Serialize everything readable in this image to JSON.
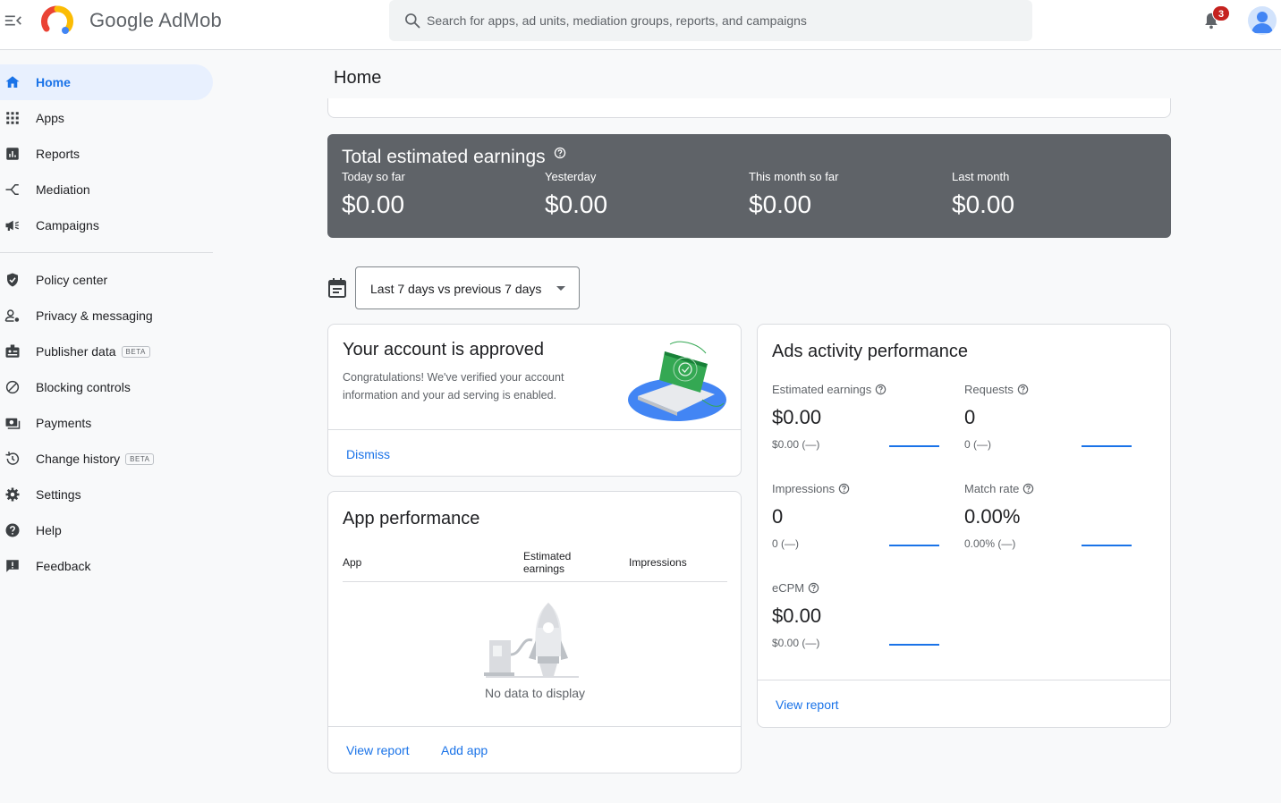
{
  "app": {
    "logo_text": "Google AdMob"
  },
  "search": {
    "placeholder": "Search for apps, ad units, mediation groups, reports, and campaigns"
  },
  "notifications": {
    "count": "3"
  },
  "sidebar": {
    "items": [
      {
        "label": "Home",
        "icon": "home-icon",
        "active": true
      },
      {
        "label": "Apps",
        "icon": "apps-grid-icon"
      },
      {
        "label": "Reports",
        "icon": "reports-icon"
      },
      {
        "label": "Mediation",
        "icon": "mediation-icon"
      },
      {
        "label": "Campaigns",
        "icon": "megaphone-icon"
      },
      {
        "label": "Policy center",
        "icon": "shield-icon"
      },
      {
        "label": "Privacy & messaging",
        "icon": "person-settings-icon"
      },
      {
        "label": "Publisher data",
        "icon": "badge-icon",
        "badge": "BETA"
      },
      {
        "label": "Blocking controls",
        "icon": "block-icon"
      },
      {
        "label": "Payments",
        "icon": "payments-icon"
      },
      {
        "label": "Change history",
        "icon": "history-icon",
        "badge": "BETA"
      },
      {
        "label": "Settings",
        "icon": "gear-icon"
      },
      {
        "label": "Help",
        "icon": "help-icon"
      },
      {
        "label": "Feedback",
        "icon": "feedback-icon"
      }
    ]
  },
  "main": {
    "title": "Home",
    "earnings": {
      "title": "Total estimated earnings",
      "columns": [
        {
          "label": "Today so far",
          "value": "$0.00"
        },
        {
          "label": "Yesterday",
          "value": "$0.00"
        },
        {
          "label": "This month so far",
          "value": "$0.00"
        },
        {
          "label": "Last month",
          "value": "$0.00"
        }
      ]
    },
    "date_range": {
      "label": "Last 7 days vs previous 7 days"
    },
    "approved_card": {
      "title": "Your account is approved",
      "text": "Congratulations! We've verified your account information and your ad serving is enabled.",
      "dismiss": "Dismiss"
    },
    "app_performance": {
      "title": "App performance",
      "columns": [
        "App",
        "Estimated earnings",
        "Impressions"
      ],
      "empty_text": "No data to display",
      "view_report": "View report",
      "add_app": "Add app"
    },
    "ads_activity": {
      "title": "Ads activity performance",
      "metrics": [
        {
          "label": "Estimated earnings",
          "value": "$0.00",
          "compare": "$0.00 (—)"
        },
        {
          "label": "Requests",
          "value": "0",
          "compare": "0 (—)"
        },
        {
          "label": "Impressions",
          "value": "0",
          "compare": "0 (—)"
        },
        {
          "label": "Match rate",
          "value": "0.00%",
          "compare": "0.00% (—)"
        },
        {
          "label": "eCPM",
          "value": "$0.00",
          "compare": "$0.00 (—)"
        }
      ],
      "view_report": "View report"
    }
  },
  "colors": {
    "accent": "#1a73e8",
    "active_bg": "#e8f0fe",
    "earnings_bg": "#5f6368",
    "badge": "#c5221f"
  }
}
